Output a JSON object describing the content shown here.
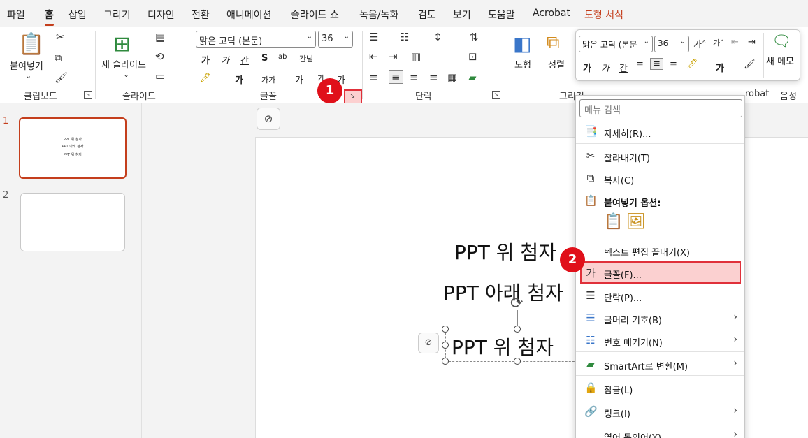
{
  "menu": {
    "tabs": [
      "파일",
      "홈",
      "삽입",
      "그리기",
      "디자인",
      "전환",
      "애니메이션",
      "슬라이드 쇼",
      "녹음/녹화",
      "검토",
      "보기",
      "도움말",
      "Acrobat",
      "도형 서식"
    ]
  },
  "ribbon": {
    "clipboard": {
      "paste_label": "붙여넣기",
      "group": "클립보드"
    },
    "slides": {
      "new_slide_label": "새 슬라이드",
      "group": "슬라이드"
    },
    "font": {
      "font_name": "맑은 고딕 (본문)",
      "font_size": "36",
      "group": "글꼴",
      "bold": "가",
      "italic": "가",
      "underline": "간",
      "shadow": "S",
      "strike": "ab",
      "spacing": "간닏",
      "grow": "가",
      "shrink": "가",
      "case": "가가",
      "color": "가",
      "clear": "가"
    },
    "paragraph": {
      "group": "단락"
    },
    "drawing": {
      "shape_label": "도형",
      "arrange_label": "정렬",
      "group": "그리기"
    },
    "adobe": {
      "group_partial": "robat"
    },
    "voice": {
      "group": "음성"
    },
    "newmemo_label": "새 메모"
  },
  "mini_toolbar": {
    "font_name": "맑은 고딕 (본문",
    "font_size": "36",
    "new_memo": "새 메모"
  },
  "slides": [
    {
      "num": "1",
      "lines": [
        "PPT 위 첨자",
        "PPT 아래 첨자",
        "PPT 위 첨자"
      ]
    },
    {
      "num": "2"
    }
  ],
  "slide_content": {
    "line1": "PPT 위 첨자",
    "line2": "PPT 아래 첨자",
    "line3": "PPT 위 첨자"
  },
  "context_menu": {
    "search_placeholder": "메뉴 검색",
    "items": [
      {
        "label": "자세히(R)...",
        "icon": "details-icon"
      },
      {
        "label": "잘라내기(T)",
        "icon": "scissors-icon"
      },
      {
        "label": "복사(C)",
        "icon": "copy-icon"
      },
      {
        "label": "붙여넣기 옵션:",
        "icon": "paste-icon"
      },
      {
        "label": "텍스트 편집 끝내기(X)",
        "icon": ""
      },
      {
        "label": "글꼴(F)...",
        "icon": "font-icon"
      },
      {
        "label": "단락(P)...",
        "icon": "paragraph-icon"
      },
      {
        "label": "글머리 기호(B)",
        "icon": "bullets-icon"
      },
      {
        "label": "번호 매기기(N)",
        "icon": "numbering-icon"
      },
      {
        "label": "SmartArt로 변환(M)",
        "icon": "smartart-icon"
      },
      {
        "label": "잠금(L)",
        "icon": "lock-icon"
      },
      {
        "label": "링크(I)",
        "icon": "link-icon"
      },
      {
        "label": "열어 동의어(Y)",
        "icon": ""
      }
    ]
  },
  "callouts": {
    "one": "1",
    "two": "2"
  },
  "colors": {
    "accent": "#c43e1c",
    "highlight": "#e0303a"
  }
}
